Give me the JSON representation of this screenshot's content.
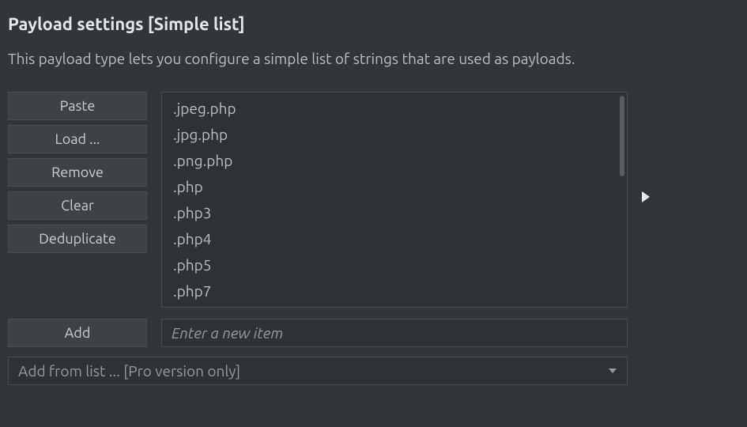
{
  "title": "Payload settings [Simple list]",
  "description": "This payload type lets you configure a simple list of strings that are used as payloads.",
  "buttons": {
    "paste": "Paste",
    "load": "Load ...",
    "remove": "Remove",
    "clear": "Clear",
    "deduplicate": "Deduplicate",
    "add": "Add"
  },
  "payload_items": [
    ".jpeg.php",
    ".jpg.php",
    ".png.php",
    ".php",
    ".php3",
    ".php4",
    ".php5",
    ".php7"
  ],
  "new_item_placeholder": "Enter a new item",
  "add_from_list_label": "Add from list ... [Pro version only]"
}
